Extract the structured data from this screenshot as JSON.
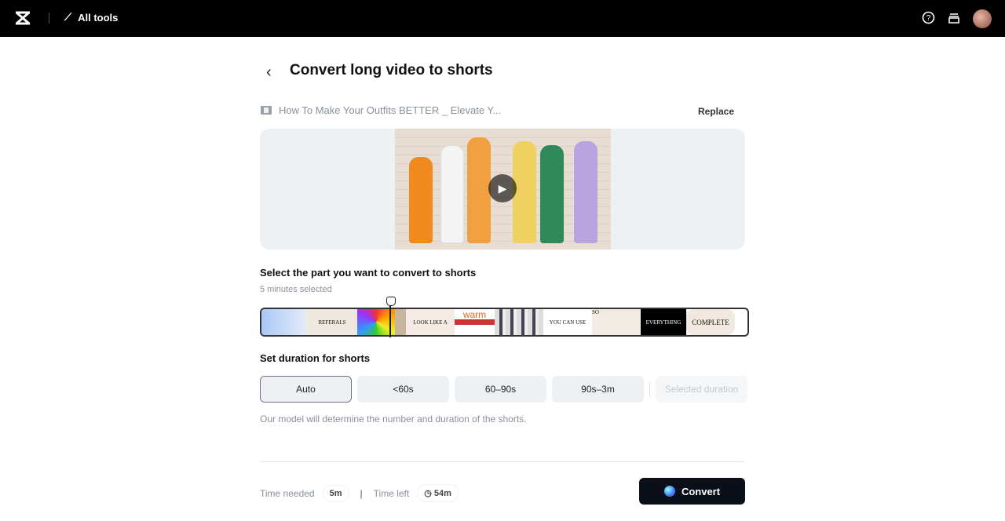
{
  "topbar": {
    "all_tools": "All tools",
    "icons": [
      "capcut-logo",
      "magic-wand-icon",
      "help-icon",
      "inbox-icon",
      "avatar"
    ]
  },
  "page": {
    "title": "Convert long video to shorts",
    "file_name": "How To Make Your Outfits BETTER _ Elevate Y...",
    "replace": "Replace"
  },
  "select": {
    "heading": "Select the part you want to convert to shorts",
    "selected": "5 minutes selected",
    "thumbs": [
      "REFERALS",
      "LOOK LIKE A",
      "warm",
      "YOU CAN USE",
      "SO",
      "EVERYTHING",
      "COMPLETE"
    ]
  },
  "duration": {
    "heading": "Set duration for shorts",
    "options": [
      "Auto",
      "<60s",
      "60–90s",
      "90s–3m",
      "Selected duration"
    ],
    "active": "Auto",
    "note": "Our model will determine the number and duration of the shorts."
  },
  "footer": {
    "time_needed_label": "Time needed",
    "time_needed": "5m",
    "time_left_label": "Time left",
    "time_left": "54m",
    "convert": "Convert"
  }
}
